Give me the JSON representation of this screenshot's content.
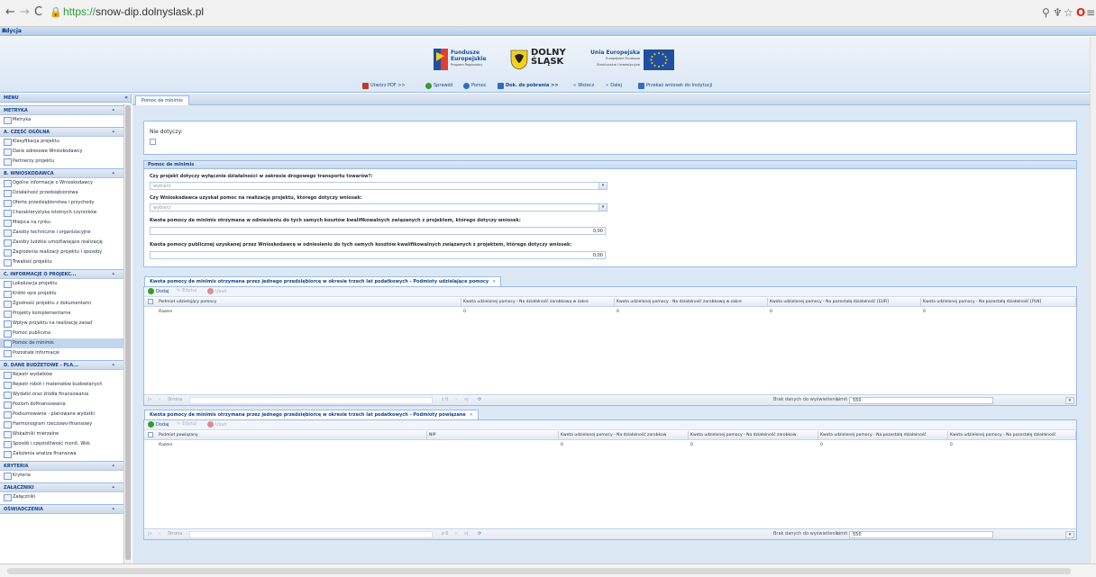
{
  "browser": {
    "url_protocol": "https://",
    "url_host": "snow-dip.dolnyslask.pl"
  },
  "window": {
    "title": "Edycja",
    "close_glyph": "×"
  },
  "header": {
    "logos": {
      "fe_line1": "Fundusze",
      "fe_line2": "Europejskie",
      "fe_line3": "Program Regionalny",
      "ds_line1": "DOLNY",
      "ds_line2": "ŚLĄSK",
      "ue_line1": "Unia Europejska",
      "ue_line2": "Europejskie Fundusze",
      "ue_line3": "Strukturalne i Inwestycyjne"
    },
    "toolbar": [
      {
        "label": "Utwórz PDF >>",
        "icon": "pdf-icon",
        "color": "#c0392b"
      },
      {
        "label": "Sprawdź",
        "icon": "check-icon",
        "color": "#3a9a2a"
      },
      {
        "label": "Pomoc",
        "icon": "help-icon",
        "color": "#2f6fc1"
      },
      {
        "label": "Dok. do pobrania >>",
        "icon": "download-icon",
        "color": "#2f6fc1"
      },
      {
        "label": "Wstecz",
        "icon": "back-icon",
        "color": "#2f6fc1"
      },
      {
        "label": "Dalej",
        "icon": "next-icon",
        "color": "#2f6fc1"
      },
      {
        "label": "Przekaż wniosek do Instytucji",
        "icon": "save-icon",
        "color": "#2f6fc1"
      }
    ]
  },
  "sidebar": {
    "title": "MENU",
    "sections": [
      {
        "title": "METRYKA",
        "items": [
          "Metryka"
        ]
      },
      {
        "title": "A. CZĘŚĆ OGÓLNA",
        "items": [
          "Klasyfikacja projektu",
          "Dane adresowe Wnioskodawcy",
          "Partnerzy projektu"
        ]
      },
      {
        "title": "B. WNIOSKODAWCA",
        "items": [
          "Ogólne informacje o Wnioskodawcy",
          "Działalność przedsiębiorstwa",
          "Oferta przedsiębiorstwa i przychody",
          "Charakterystyka istotnych czynników",
          "Miejsca na rynku",
          "Zasoby techniczne i organizacyjne",
          "Zasoby ludzkie umożliwiające realizację",
          "Zagrożenia realizacji projektu i sposoby",
          "Trwałość projektu"
        ]
      },
      {
        "title": "C. INFORMACJE O PROJEKC...",
        "items": [
          "Lokalizacja projektu",
          "Krótki opis projektu",
          "Zgodność projektu z dokumentami",
          "Projekty komplementarne",
          "Wpływ projektu na realizację zasad",
          "Pomoc publiczna",
          "Pomoc de minimis",
          "Pozostałe informacje"
        ]
      },
      {
        "title": "D. DANE BUDŻETOWE - PLA...",
        "items": [
          "Rejestr wydatków",
          "Rejestr robót i materiałów budowlanych",
          "Wydatki oraz źródła finansowania",
          "Poziom dofinansowania",
          "Podsumowanie - planowane wydatki",
          "Harmonogram rzeczowo-finansowy",
          "Wskaźniki mierzalne",
          "Sposób i częstotliwość monit. Wsk.",
          "Założenia analiza finansowa"
        ]
      },
      {
        "title": "KRYTERIA",
        "items": [
          "Kryteria"
        ]
      },
      {
        "title": "ZAŁĄCZNIKI",
        "items": [
          "Załączniki"
        ]
      },
      {
        "title": "OŚWIADCZENIA",
        "items": []
      }
    ],
    "selected_item": "Pomoc de minimis"
  },
  "main": {
    "tab_label": "Pomoc de minimis",
    "nie_dotyczy_label": "Nie dotyczy:",
    "deminimis_panel": {
      "title": "Pomoc de minimis",
      "q1": "Czy projekt dotyczy wyłącznie działalności w zakresie drogowego transportu towarów?:",
      "q1_placeholder": "wybierz",
      "q2": "Czy Wnioskodawca uzyskał pomoc na realizację projektu, którego dotyczy wniosek:",
      "q2_placeholder": "wybierz",
      "q3": "Kwota pomocy de minimis otrzymana w odniesieniu do tych samych kosztów kwalifikowalnych związanych z projektem, którego dotyczy wniosek:",
      "q3_value": "0,00",
      "q4": "Kwota pomocy publicznej uzyskanej przez Wnioskodawcę w odniesieniu do tych samych kosztów kwalifikowalnych związanych z projektem, którego dotyczy wniosek:",
      "q4_value": "0,00"
    },
    "grid1": {
      "tab": "Kwota pomocy de minimis otrzymana przez jednego przedsiębiorcę w okresie trzech lat podatkowych - Podmioty udzielające pomocy",
      "buttons": {
        "add": "Dodaj",
        "edit": "Edytuj",
        "delete": "Usuń"
      },
      "columns": [
        "Podmiot udzielający pomocy",
        "Kwota udzielonej pomocy - Na działalność zarobkową w zakre",
        "Kwota udzielonej pomocy - Na działalność zarobkową w zakre",
        "Kwota udzielonej pomocy - Na pozostałą działalność [EUR]",
        "Kwota udzielonej pomocy - Na pozostałą działalność [PLN]"
      ],
      "total_row": [
        "Razem",
        "0",
        "0",
        "0",
        "0"
      ],
      "pager": {
        "page_label": "Strona",
        "of_label": "z 0",
        "no_data": "Brak danych do wyświetlenia",
        "limit_label": "Limit",
        "limit_value": "550"
      }
    },
    "grid2": {
      "tab": "Kwota pomocy de minimis otrzymana przez jednego przedsiębiorcę w okresie trzech lat podatkowych - Podmioty powiązane",
      "buttons": {
        "add": "Dodaj",
        "edit": "Edytuj",
        "delete": "Usuń"
      },
      "columns": [
        "Podmiot powiązany",
        "NIP",
        "Kwota udzielonej pomocy - Na działalność zarobkow",
        "Kwota udzielonej pomocy - Na działalność zarobkow",
        "Kwota udzielonej pomocy - Na pozostałą działalność",
        "Kwota udzielonej pomocy - Na pozostałą działalność"
      ],
      "total_row": [
        "Razem",
        "",
        "0",
        "0",
        "0",
        "0"
      ],
      "pager": {
        "page_label": "Strona",
        "of_label": "z 0",
        "no_data": "Brak danych do wyświetlenia",
        "limit_label": "Limit",
        "limit_value": "550"
      }
    }
  }
}
